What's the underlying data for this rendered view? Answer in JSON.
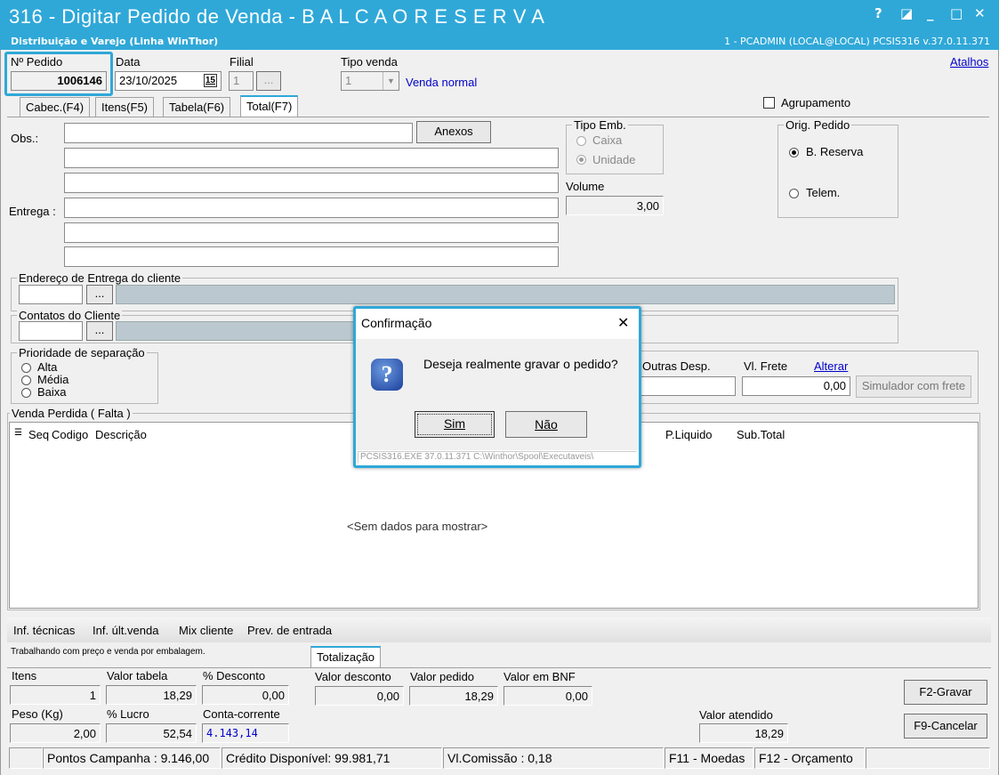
{
  "window": {
    "title": "316 - Digitar Pedido de Venda - B A L C A O   R E S E R V A",
    "subtitle": "Distribuição e Varejo (Linha WinThor)",
    "session": "1 - PCADMIN (LOCAL@LOCAL)   PCSIS316  v.37.0.11.371",
    "controls": {
      "help": "?",
      "restore": "◪",
      "minimize": "_",
      "maximize": "□",
      "close": "✕"
    }
  },
  "header": {
    "pedido_label": "Nº Pedido",
    "pedido_value": "1006146",
    "data_label": "Data",
    "data_value": "23/10/2025",
    "calendar_glyph": "15",
    "filial_label": "Filial",
    "filial_value": "1",
    "filial_button": "...",
    "tipo_venda_label": "Tipo venda",
    "tipo_venda_value": "1",
    "tipo_venda_desc": "Venda normal",
    "atalhos": "Atalhos",
    "agrupamento": "Agrupamento"
  },
  "tabs": [
    "Cabec.(F4)",
    "Itens(F5)",
    "Tabela(F6)",
    "Total(F7)"
  ],
  "form": {
    "obs_label": "Obs.:",
    "anexos": "Anexos",
    "entrega_label": "Entrega :",
    "tipo_emb": {
      "title": "Tipo Emb.",
      "caixa": "Caixa",
      "unidade": "Unidade"
    },
    "volume_label": "Volume",
    "volume_value": "3,00",
    "orig_pedido": {
      "title": "Orig. Pedido",
      "reserva": "B. Reserva",
      "telem": "Telem."
    },
    "endereco_title": "Endereço de Entrega do cliente",
    "contatos_title": "Contatos do Cliente",
    "ellipsis": "...",
    "prioridade": {
      "title": "Prioridade de separação",
      "alta": "Alta",
      "media": "Média",
      "baixa": "Baixa"
    },
    "outras_desp_label": "Outras Desp.",
    "vl_frete_label": "Vl. Frete",
    "alterar": "Alterar",
    "vl_frete_value": "0,00",
    "simulador": "Simulador com frete"
  },
  "venda_perdida": {
    "title": "Venda Perdida ( Falta )",
    "columns": [
      "Seq",
      "Codigo",
      "Descrição",
      "P.Liquido",
      "Sub.Total"
    ],
    "empty": "<Sem dados para mostrar>"
  },
  "links_bar": [
    "Inf. técnicas",
    "Inf. últ.venda",
    "Mix cliente",
    "Prev. de entrada"
  ],
  "totals": {
    "note": "Trabalhando com preço e venda por embalagem.",
    "tab": "Totalização",
    "itens_label": "Itens",
    "itens_value": "1",
    "valor_tabela_label": "Valor tabela",
    "valor_tabela_value": "18,29",
    "desconto_label": "% Desconto",
    "desconto_value": "0,00",
    "peso_label": "Peso (Kg)",
    "peso_value": "2,00",
    "lucro_label": "% Lucro",
    "lucro_value": "52,54",
    "cc_label": "Conta-corrente",
    "cc_value": "4.143,14",
    "valor_desconto_label": "Valor desconto",
    "valor_desconto_value": "0,00",
    "valor_pedido_label": "Valor pedido",
    "valor_pedido_value": "18,29",
    "valor_bnf_label": "Valor em BNF",
    "valor_bnf_value": "0,00",
    "valor_atendido_label": "Valor atendido",
    "valor_atendido_value": "18,29",
    "gravar": "F2-Gravar",
    "cancelar": "F9-Cancelar"
  },
  "status": {
    "pontos": "Pontos Campanha : 9.146,00",
    "credito": "Crédito Disponível: 99.981,71",
    "comissao": "Vl.Comissão : 0,18",
    "moedas": "F11 - Moedas",
    "orcamento": "F12 - Orçamento"
  },
  "dialog": {
    "title": "Confirmação",
    "close": "✕",
    "message": "Deseja realmente gravar o pedido?",
    "icon": "?",
    "yes": "Sim",
    "no": "Não",
    "footer": "PCSIS316.EXE 37.0.11.371 C:\\Winthor\\Spool\\Executaveis\\"
  },
  "colors": {
    "accent": "#2fa8d8",
    "link": "#0000cc"
  }
}
